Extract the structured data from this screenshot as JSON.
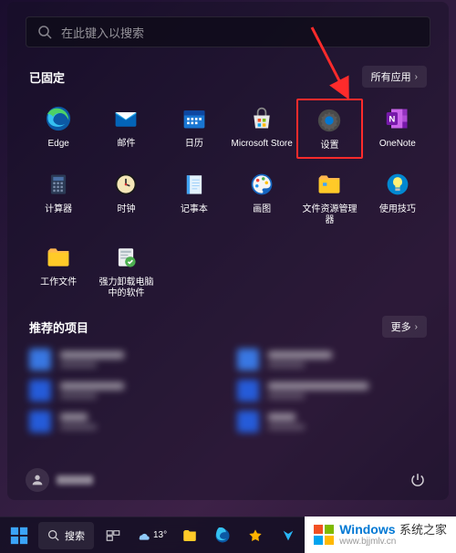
{
  "search": {
    "placeholder": "在此键入以搜索"
  },
  "pinned": {
    "title": "已固定",
    "all_apps_label": "所有应用",
    "apps": [
      {
        "label": "Edge"
      },
      {
        "label": "邮件"
      },
      {
        "label": "日历"
      },
      {
        "label": "Microsoft Store"
      },
      {
        "label": "设置"
      },
      {
        "label": "OneNote"
      },
      {
        "label": "计算器"
      },
      {
        "label": "时钟"
      },
      {
        "label": "记事本"
      },
      {
        "label": "画图"
      },
      {
        "label": "文件资源管理器"
      },
      {
        "label": "使用技巧"
      },
      {
        "label": "工作文件"
      },
      {
        "label": "强力卸载电脑中的软件"
      }
    ]
  },
  "recommended": {
    "title": "推荐的项目",
    "more_label": "更多"
  },
  "taskbar": {
    "search_label": "搜索",
    "weather_temp": "13°"
  },
  "watermark": {
    "brand": "Windows",
    "suffix": "系统之家",
    "url": "www.bjjmlv.cn"
  },
  "highlighted_app_index": 4
}
